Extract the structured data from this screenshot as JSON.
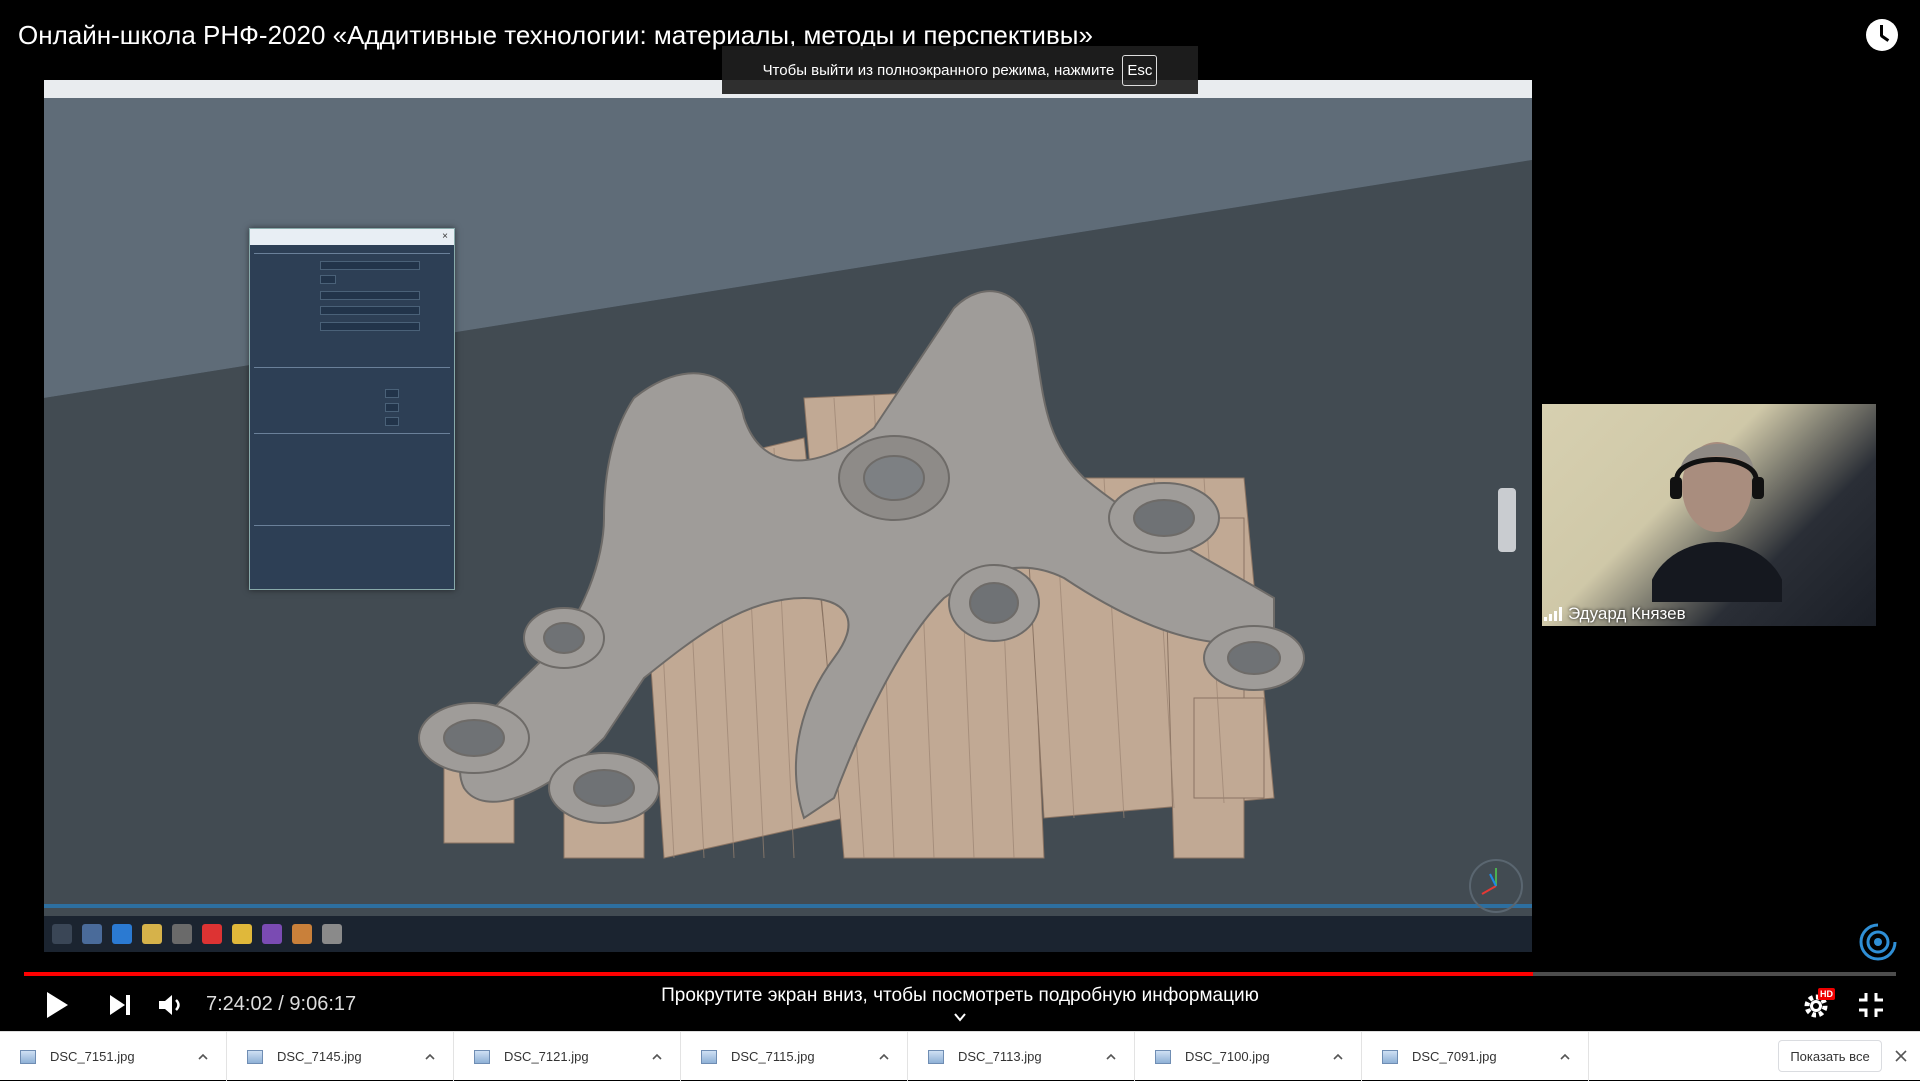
{
  "video": {
    "title": "Онлайн-школа РНФ-2020 «Аддитивные технологии: материалы, методы и перспективы»",
    "time_display": "7:24:02 / 9:06:17",
    "progress_fraction": 0.806,
    "scroll_hint": "Прокрутите экран вниз, чтобы посмотреть подробную информацию",
    "quality_badge": "HD"
  },
  "fullscreen_toast": {
    "message": "Чтобы выйти из полноэкранного режима, нажмите",
    "key": "Esc"
  },
  "webcam": {
    "participant_name": "Эдуард Князев"
  },
  "downloads": {
    "items": [
      {
        "name": "DSC_7151.jpg"
      },
      {
        "name": "DSC_7145.jpg"
      },
      {
        "name": "DSC_7121.jpg"
      },
      {
        "name": "DSC_7115.jpg"
      },
      {
        "name": "DSC_7113.jpg"
      },
      {
        "name": "DSC_7100.jpg"
      },
      {
        "name": "DSC_7091.jpg"
      }
    ],
    "show_all_label": "Показать все"
  },
  "colors": {
    "progress": "#ff0000",
    "part_metal": "#a8a6a4",
    "support_struts": "#c2aa97"
  }
}
